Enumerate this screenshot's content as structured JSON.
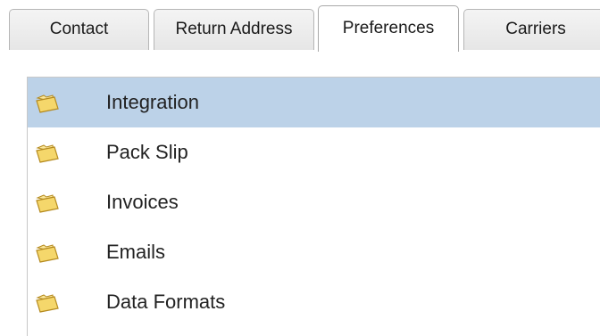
{
  "tabs": [
    {
      "label": "Contact",
      "active": false
    },
    {
      "label": "Return Address",
      "active": false
    },
    {
      "label": "Preferences",
      "active": true
    },
    {
      "label": "Carriers",
      "active": false
    }
  ],
  "colors": {
    "selection": "#bcd2e8",
    "folder_fill": "#f5d76b",
    "folder_stroke": "#b58a1e"
  },
  "preferences_list": {
    "selected_index": 0,
    "items": [
      {
        "label": "Integration",
        "icon": "folder-icon"
      },
      {
        "label": "Pack Slip",
        "icon": "folder-icon"
      },
      {
        "label": "Invoices",
        "icon": "folder-icon"
      },
      {
        "label": "Emails",
        "icon": "folder-icon"
      },
      {
        "label": "Data Formats",
        "icon": "folder-icon"
      }
    ]
  }
}
